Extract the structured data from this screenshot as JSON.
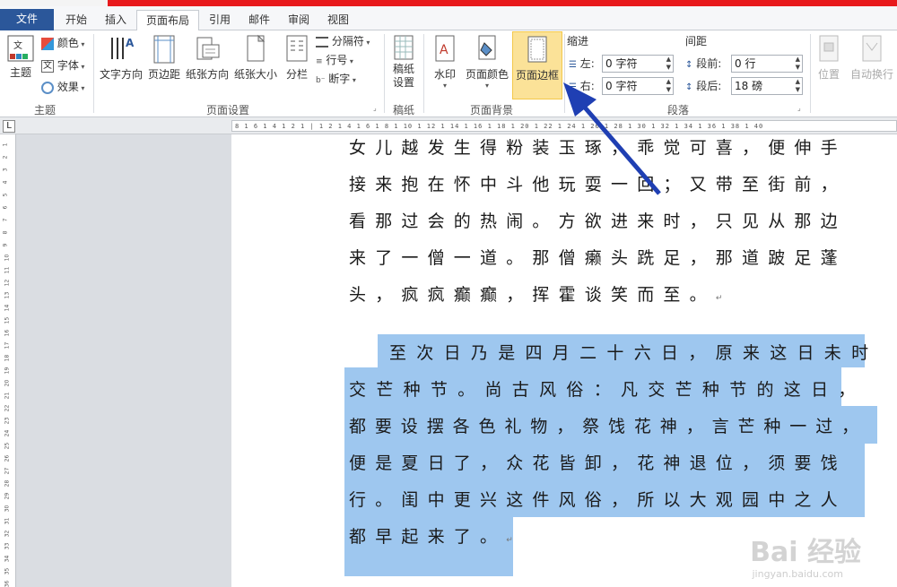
{
  "tabs": [
    "文件",
    "开始",
    "插入",
    "页面布局",
    "引用",
    "邮件",
    "审阅",
    "视图"
  ],
  "ribbon": {
    "theme": {
      "main": "主题",
      "colors": "颜色",
      "fonts": "字体",
      "effects": "效果",
      "group": "主题"
    },
    "page_setup": {
      "text_direction": "文字方向",
      "margins": "页边距",
      "orientation": "纸张方向",
      "size": "纸张大小",
      "columns": "分栏",
      "breaks": "分隔符",
      "line_numbers": "行号",
      "hyphenation": "断字",
      "group": "页面设置"
    },
    "draft": {
      "settings": "稿纸\n设置",
      "group": "稿纸"
    },
    "page_background": {
      "watermark": "水印",
      "page_color": "页面颜色",
      "page_borders": "页面边框",
      "group": "页面背景"
    },
    "paragraph": {
      "indent_title": "缩进",
      "spacing_title": "间距",
      "left_label": "左:",
      "left_value": "0 字符",
      "right_label": "右:",
      "right_value": "0 字符",
      "before_label": "段前:",
      "before_value": "0 行",
      "after_label": "段后:",
      "after_value": "18 磅",
      "group": "段落"
    },
    "arrange": {
      "position": "位置",
      "wrap": "自动换行"
    }
  },
  "ruler": {
    "marks": "8 1 6 1 4 1 2 1 | 1 2 1 4 1 6 1 8 1 10 1 12 1 14 1 16 1 18 1 20 1 22 1 24 1 26 1 28 1 30 1 32 1 34 1 36 1 38 1 40"
  },
  "vruler_numbers": [
    "1",
    "2",
    "3",
    "4",
    "5",
    "6",
    "7",
    "8",
    "9",
    "10",
    "11",
    "12",
    "13",
    "14",
    "15",
    "16",
    "17",
    "18",
    "19",
    "20",
    "21",
    "22",
    "23",
    "24",
    "25",
    "26",
    "27",
    "28",
    "29",
    "30",
    "31",
    "32",
    "33",
    "34",
    "35",
    "36"
  ],
  "document": {
    "para1": [
      "女儿越发生得粉装玉琢，乖觉可喜，便伸手",
      "接来抱在怀中斗他玩耍一回；又带至街前，",
      "看那过会的热闹。方欲进来时，只见从那边",
      "来了一僧一道。那僧癞头跣足，那道跛足蓬",
      "头，疯疯癫癫，挥霍谈笑而至。"
    ],
    "para2": [
      "至次日乃是四月二十六日，原来这日未时",
      "交芒种节。尚古风俗：凡交芒种节的这日，",
      "都要设摆各色礼物，祭饯花神，言芒种一过，",
      "便是夏日了，众花皆卸，花神退位，须要饯",
      "行。闺中更兴这件风俗，所以大观园中之人",
      "都早起来了。"
    ],
    "para_mark": "↵"
  },
  "watermark": {
    "main": "Bai 经验",
    "sub": "jingyan.baidu.com"
  },
  "colors": {
    "selection": "#9ec7ef",
    "arrow": "#1f3fb3",
    "highlight": "#fbe298",
    "file_tab": "#2b579a"
  }
}
